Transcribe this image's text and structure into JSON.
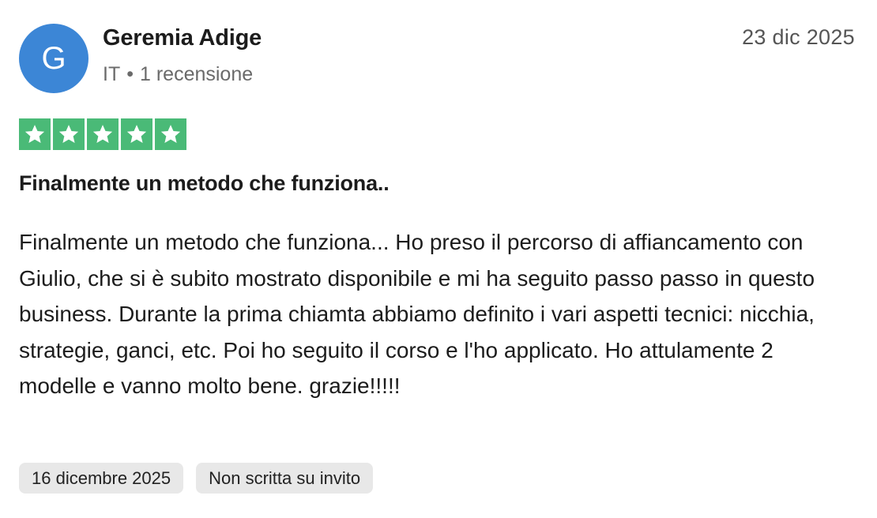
{
  "reviewer": {
    "initial": "G",
    "name": "Geremia Adige",
    "country": "IT",
    "separator": "•",
    "review_count": "1 recensione",
    "avatar_color": "#3c86d6"
  },
  "review": {
    "date": "23 dic 2025",
    "rating": 5,
    "rating_max": 5,
    "star_color": "#4aba77",
    "title": "Finalmente un metodo che funziona..",
    "body": "Finalmente un metodo che funziona... Ho preso il percorso di affiancamento con Giulio, che si è subito mostrato disponibile e mi ha seguito passo passo in questo business. Durante la prima chiamta abbiamo definito i vari aspetti tecnici: nicchia, strategie, ganci, etc. Poi ho seguito il corso e l'ho applicato. Ho attulamente 2 modelle e vanno molto bene. grazie!!!!!"
  },
  "tags": {
    "experience_date": "16 dicembre 2025",
    "invite_status": "Non scritta su invito"
  }
}
